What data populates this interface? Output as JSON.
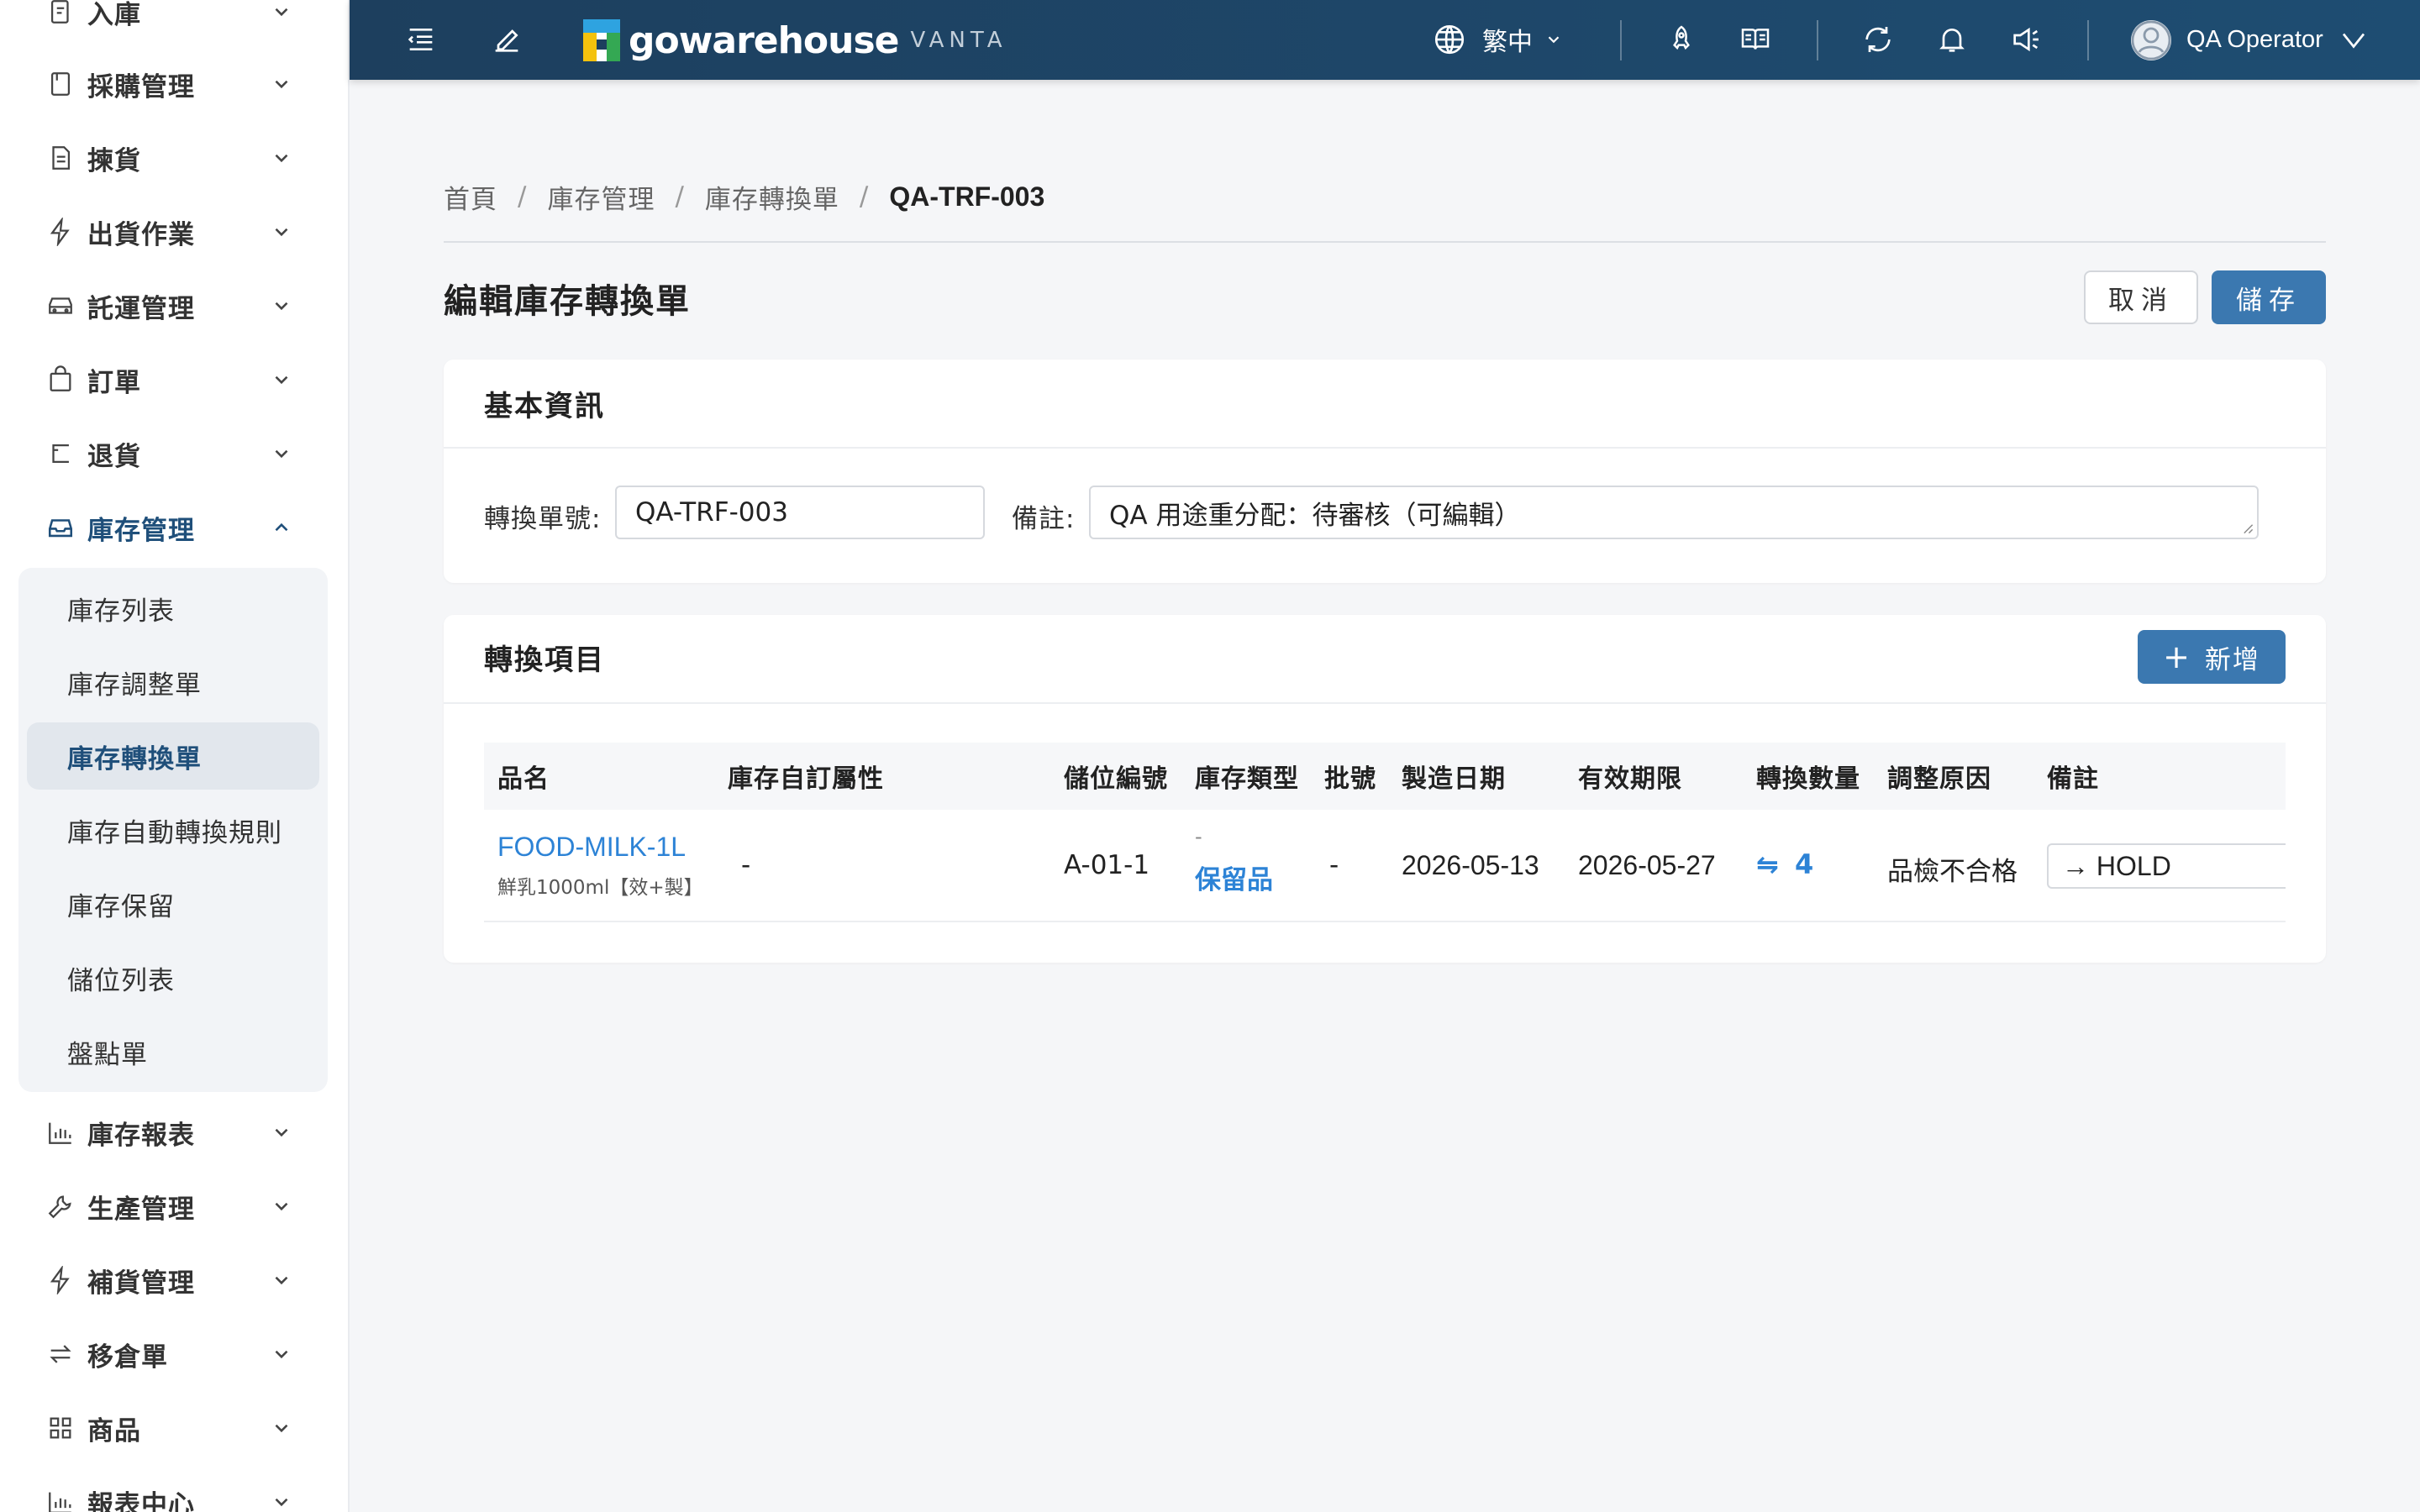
{
  "sidebar": {
    "items": [
      {
        "label": "入庫",
        "icon": "inbound-icon"
      },
      {
        "label": "採購管理",
        "icon": "purchase-icon"
      },
      {
        "label": "揀貨",
        "icon": "picking-icon"
      },
      {
        "label": "出貨作業",
        "icon": "lightning-icon"
      },
      {
        "label": "託運管理",
        "icon": "truck-icon"
      },
      {
        "label": "訂單",
        "icon": "bag-icon"
      },
      {
        "label": "退貨",
        "icon": "return-icon"
      },
      {
        "label": "庫存管理",
        "icon": "inbox-icon"
      },
      {
        "label": "庫存報表",
        "icon": "bar-chart-icon"
      },
      {
        "label": "生產管理",
        "icon": "wrench-icon"
      },
      {
        "label": "補貨管理",
        "icon": "lightning-icon"
      },
      {
        "label": "移倉單",
        "icon": "transfer-icon"
      },
      {
        "label": "商品",
        "icon": "grid-icon"
      },
      {
        "label": "報表中心",
        "icon": "bar-chart-icon"
      }
    ],
    "inventory_sub": [
      {
        "label": "庫存列表"
      },
      {
        "label": "庫存調整單"
      },
      {
        "label": "庫存轉換單"
      },
      {
        "label": "庫存自動轉換規則"
      },
      {
        "label": "庫存保留"
      },
      {
        "label": "儲位列表"
      },
      {
        "label": "盤點單"
      }
    ]
  },
  "topbar": {
    "logo_text": "gowarehouse",
    "logo_sub": "VANTA",
    "language": "繁中",
    "user_name": "QA Operator"
  },
  "breadcrumb": {
    "home": "首頁",
    "level1": "庫存管理",
    "level2": "庫存轉換單",
    "current": "QA-TRF-003",
    "separator": "/"
  },
  "page": {
    "title": "編輯庫存轉換單",
    "cancel_label": "取消",
    "save_label": "儲存"
  },
  "basic_info": {
    "title": "基本資訊",
    "order_no_label": "轉換單號:",
    "order_no_value": "QA-TRF-003",
    "note_label": "備註:",
    "note_value": "QA 用途重分配：待審核（可編輯）"
  },
  "items": {
    "title": "轉換項目",
    "add_label": "新增",
    "columns": [
      "品名",
      "庫存自訂屬性",
      "儲位編號",
      "庫存類型",
      "批號",
      "製造日期",
      "有效期限",
      "轉換數量",
      "調整原因",
      "備註"
    ],
    "rows": [
      {
        "sku": "FOOD-MILK-1L",
        "product_name": "鮮乳1000ml【效+製】",
        "custom_attr": "-",
        "location": "A-01-1",
        "stock_type_from": "-",
        "stock_type_to": "保留品",
        "batch": "-",
        "mfg_date": "2026-05-13",
        "exp_date": "2026-05-27",
        "qty_icon": "⇋",
        "qty": "4",
        "reason": "品檢不合格",
        "note": "→ HOLD"
      }
    ]
  },
  "colors": {
    "topbar": "#1e4d72",
    "primary": "#3b78b0",
    "link": "#2d83d6",
    "active_menu": "#1f4f7a"
  }
}
